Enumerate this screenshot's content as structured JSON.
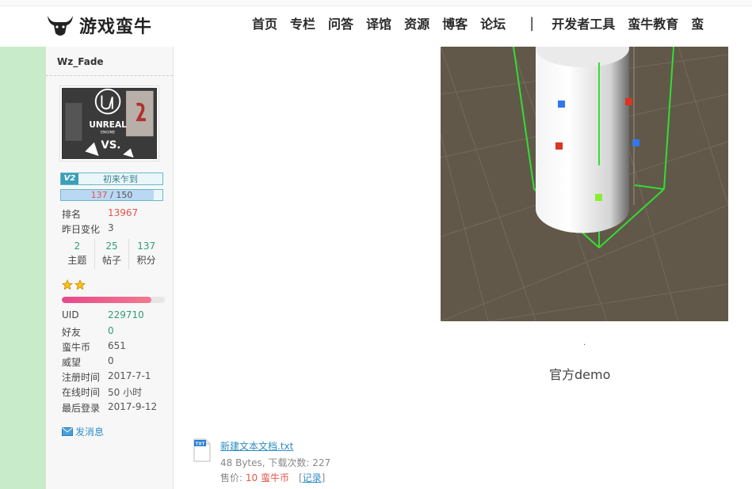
{
  "brand": {
    "logo_text": "游戏蛮牛"
  },
  "nav": {
    "items": [
      "首页",
      "专栏",
      "问答",
      "译馆",
      "资源",
      "博客",
      "论坛"
    ],
    "separator": "|",
    "right_items": [
      "开发者工具",
      "蛮牛教育",
      "蛮"
    ]
  },
  "profile": {
    "username": "Wz_Fade",
    "avatar_text": {
      "brand": "UNREAL",
      "sub": "ENGINE",
      "vs": "VS."
    },
    "level": {
      "badge": "V2",
      "name": "初来乍到"
    },
    "progress": {
      "current": "137",
      "slash": " / ",
      "max": "150",
      "fraction": 0.913
    },
    "rank": {
      "label": "排名",
      "value": "13967"
    },
    "yesterday": {
      "label": "昨日变化",
      "value": "3"
    },
    "stats": [
      {
        "num": "2",
        "label": "主题"
      },
      {
        "num": "25",
        "label": "帖子"
      },
      {
        "num": "137",
        "label": "积分"
      }
    ],
    "stars": 2,
    "reputation_fraction": 0.87,
    "details": [
      {
        "label": "UID",
        "value": "229710",
        "color": "green"
      },
      {
        "label": "好友",
        "value": "0",
        "color": "green"
      },
      {
        "label": "蛮牛币",
        "value": "651",
        "color": ""
      },
      {
        "label": "威望",
        "value": "0",
        "color": ""
      },
      {
        "label": "注册时间",
        "value": "2017-7-1",
        "color": ""
      },
      {
        "label": "在线时间",
        "value": "50 小时",
        "color": ""
      },
      {
        "label": "最后登录",
        "value": "2017-9-12",
        "color": ""
      }
    ],
    "send_message": "发消息"
  },
  "content": {
    "dot": ".",
    "caption": "官方demo"
  },
  "attachment": {
    "filename": "新建文本文档.txt",
    "meta": "48 Bytes, 下载次数: 227",
    "price_label": "售价: ",
    "price_amount": "10 蛮牛币",
    "record_open": "[",
    "record": "记录",
    "record_close": "]",
    "icon_label": "TXT"
  },
  "colors": {
    "left_strip": "#c8ebc9",
    "accent_red": "#e5534b",
    "accent_green": "#2f9e77",
    "link_blue": "#2f8fc4",
    "scene_ground": "#615849",
    "collider_green": "#33dd33"
  }
}
